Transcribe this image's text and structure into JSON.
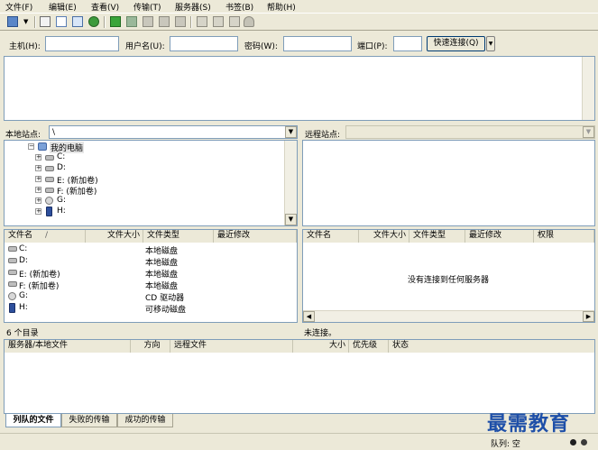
{
  "menu": [
    "文件(F)",
    "编辑(E)",
    "查看(V)",
    "传输(T)",
    "服务器(S)",
    "书签(B)",
    "帮助(H)"
  ],
  "quickconnect": {
    "host_label": "主机(H):",
    "user_label": "用户名(U):",
    "pass_label": "密码(W):",
    "port_label": "端口(P):",
    "connect_button": "快速连接(Q)",
    "dropdown_arrow": "▼"
  },
  "local": {
    "site_label": "本地站点:",
    "path": "\\",
    "tree": [
      {
        "label": "我的电脑",
        "icon": "computer-icon"
      },
      {
        "label": "C:",
        "icon": "drive-icon"
      },
      {
        "label": "D:",
        "icon": "drive-icon"
      },
      {
        "label": "E: (新加卷)",
        "icon": "drive-icon"
      },
      {
        "label": "F: (新加卷)",
        "icon": "drive-icon"
      },
      {
        "label": "G:",
        "icon": "cd-drive-icon"
      },
      {
        "label": "H:",
        "icon": "removable-drive-icon"
      }
    ],
    "columns": [
      "文件名",
      "文件大小",
      "文件类型",
      "最近修改"
    ],
    "sort_indicator": "/",
    "files": [
      {
        "name": "C:",
        "type": "本地磁盘",
        "icon": "drive-icon"
      },
      {
        "name": "D:",
        "type": "本地磁盘",
        "icon": "drive-icon"
      },
      {
        "name": "E: (新加卷)",
        "type": "本地磁盘",
        "icon": "drive-icon"
      },
      {
        "name": "F: (新加卷)",
        "type": "本地磁盘",
        "icon": "drive-icon"
      },
      {
        "name": "G:",
        "type": "CD 驱动器",
        "icon": "cd-drive-icon"
      },
      {
        "name": "H:",
        "type": "可移动磁盘",
        "icon": "removable-drive-icon"
      }
    ],
    "status": "6 个目录"
  },
  "remote": {
    "site_label": "远程站点:",
    "columns": [
      "文件名",
      "文件大小",
      "文件类型",
      "最近修改",
      "权限"
    ],
    "empty_message": "没有连接到任何服务器",
    "status": "未连接。"
  },
  "queue": {
    "columns": [
      "服务器/本地文件",
      "方向",
      "远程文件",
      "大小",
      "优先级",
      "状态"
    ],
    "tabs": [
      "列队的文件",
      "失败的传输",
      "成功的传输"
    ],
    "queue_label": "队列: 空"
  },
  "watermark": "最需教育",
  "colors": {
    "accent": "#0a246a",
    "border": "#7f9db9",
    "face": "#ece9d8"
  }
}
